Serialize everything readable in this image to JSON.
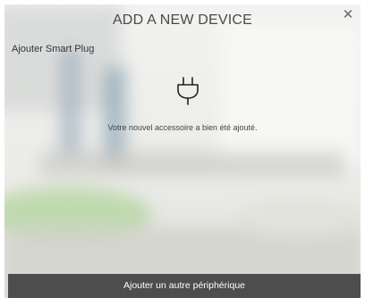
{
  "dialog": {
    "title": "ADD A NEW DEVICE",
    "close_icon": "close-icon",
    "subtitle": "Ajouter Smart Plug",
    "device_icon": "plug-icon",
    "message": "Votre nouvel accessoire a bien été ajouté.",
    "footer_button_label": "Ajouter un autre périphérique"
  },
  "colors": {
    "footer_bg": "#4d4d4d",
    "footer_text": "#ffffff",
    "title_text": "#4a4a4a"
  }
}
